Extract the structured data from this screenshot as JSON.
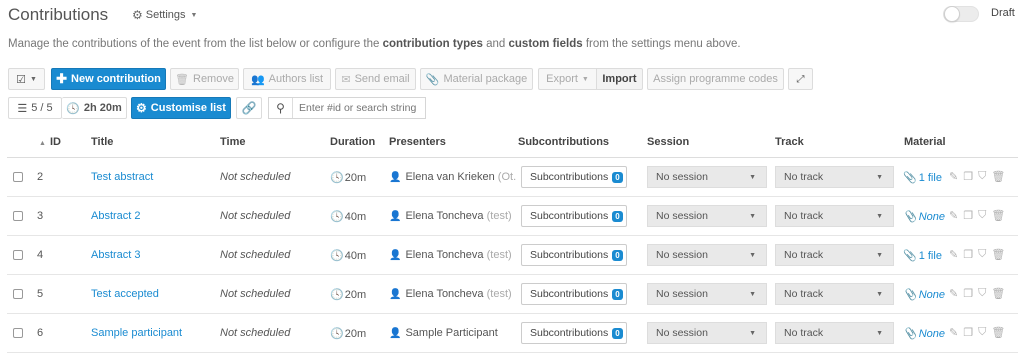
{
  "header": {
    "title": "Contributions",
    "settings_label": "Settings",
    "draft_label": "Draft"
  },
  "description": {
    "part1": "Manage the contributions of the event from the list below or configure the ",
    "link1": "contribution types",
    "part2": " and ",
    "link2": "custom fields",
    "part3": " from the settings menu above."
  },
  "toolbar": {
    "new_contribution": "New contribution",
    "remove": "Remove",
    "authors_list": "Authors list",
    "send_email": "Send email",
    "material_package": "Material package",
    "export": "Export",
    "import": "Import",
    "assign_codes": "Assign programme codes"
  },
  "toolbar2": {
    "count": "5 / 5",
    "duration_total": "2h 20m",
    "customise": "Customise list",
    "search_placeholder": "Enter #id or search string"
  },
  "table": {
    "headers": {
      "id": "ID",
      "title": "Title",
      "time": "Time",
      "duration": "Duration",
      "presenters": "Presenters",
      "subcontributions": "Subcontributions",
      "session": "Session",
      "track": "Track",
      "material": "Material"
    },
    "rows": [
      {
        "id": "2",
        "title": "Test abstract",
        "time": "Not scheduled",
        "duration": "20m",
        "presenter": "Elena van Krieken",
        "affiliation": "(Ot...",
        "subc_label": "Subcontributions",
        "subc_count": "0",
        "session": "No session",
        "track": "No track",
        "material": "1 file",
        "material_none": false
      },
      {
        "id": "3",
        "title": "Abstract 2",
        "time": "Not scheduled",
        "duration": "40m",
        "presenter": "Elena Toncheva",
        "affiliation": "(test)",
        "subc_label": "Subcontributions",
        "subc_count": "0",
        "session": "No session",
        "track": "No track",
        "material": "None",
        "material_none": true
      },
      {
        "id": "4",
        "title": "Abstract 3",
        "time": "Not scheduled",
        "duration": "40m",
        "presenter": "Elena Toncheva",
        "affiliation": "(test)",
        "subc_label": "Subcontributions",
        "subc_count": "0",
        "session": "No session",
        "track": "No track",
        "material": "1 file",
        "material_none": false
      },
      {
        "id": "5",
        "title": "Test accepted",
        "time": "Not scheduled",
        "duration": "20m",
        "presenter": "Elena Toncheva",
        "affiliation": "(test)",
        "subc_label": "Subcontributions",
        "subc_count": "0",
        "session": "No session",
        "track": "No track",
        "material": "None",
        "material_none": true
      },
      {
        "id": "6",
        "title": "Sample participant",
        "time": "Not scheduled",
        "duration": "20m",
        "presenter": "Sample Participant",
        "affiliation": "",
        "subc_label": "Subcontributions",
        "subc_count": "0",
        "session": "No session",
        "track": "No track",
        "material": "None",
        "material_none": true
      }
    ]
  },
  "colors": {
    "accent": "#1a8bd1"
  }
}
